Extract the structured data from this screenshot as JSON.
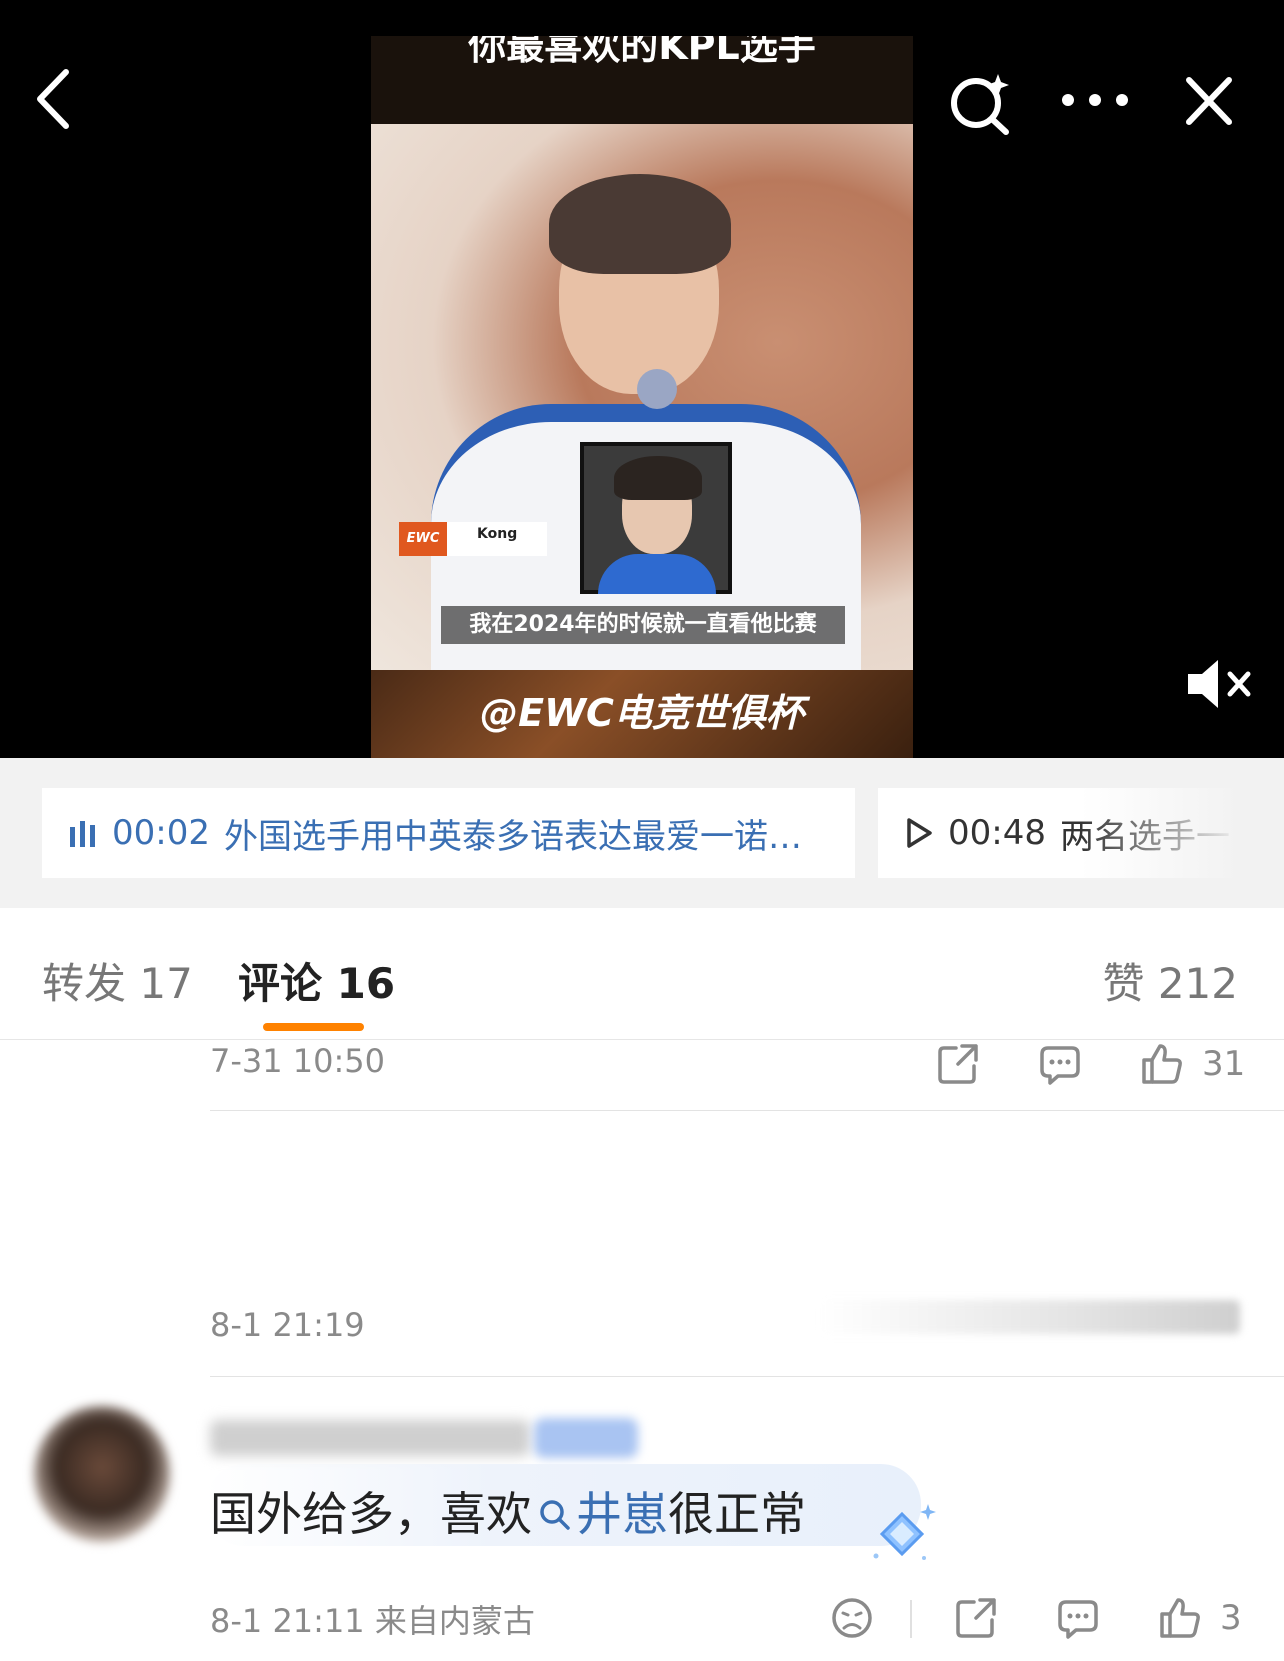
{
  "video": {
    "top_caption": "你最喜欢的KPL选手",
    "player_tag": {
      "brand": "EWC",
      "name": "Kong"
    },
    "subtitle": "我在2024年的时候就一直看他比赛",
    "watermark": "@EWC电竞世俱杯",
    "muted": true
  },
  "chapters": [
    {
      "icon": "bars-icon",
      "time": "00:02",
      "title": "外国选手用中英泰多语表达最爱一诺…",
      "active": true
    },
    {
      "icon": "play-icon",
      "time": "00:48",
      "title": "两名选手一",
      "active": false
    }
  ],
  "tabs": {
    "repost": "转发 17",
    "comment": "评论 16",
    "like": "赞 212"
  },
  "comments": [
    {
      "time": "7-31 10:50",
      "like_count": "31"
    },
    {
      "time": "8-1 21:19"
    },
    {
      "text_before": "国外给多，喜欢",
      "keyword": "井崽",
      "text_after": "很正常",
      "time": "8-1 21:11 来自内蒙古",
      "like_count": "3"
    }
  ],
  "colors": {
    "accent": "#ff8200",
    "link": "#3a6fb3",
    "muted_text": "#8a8a8a"
  }
}
